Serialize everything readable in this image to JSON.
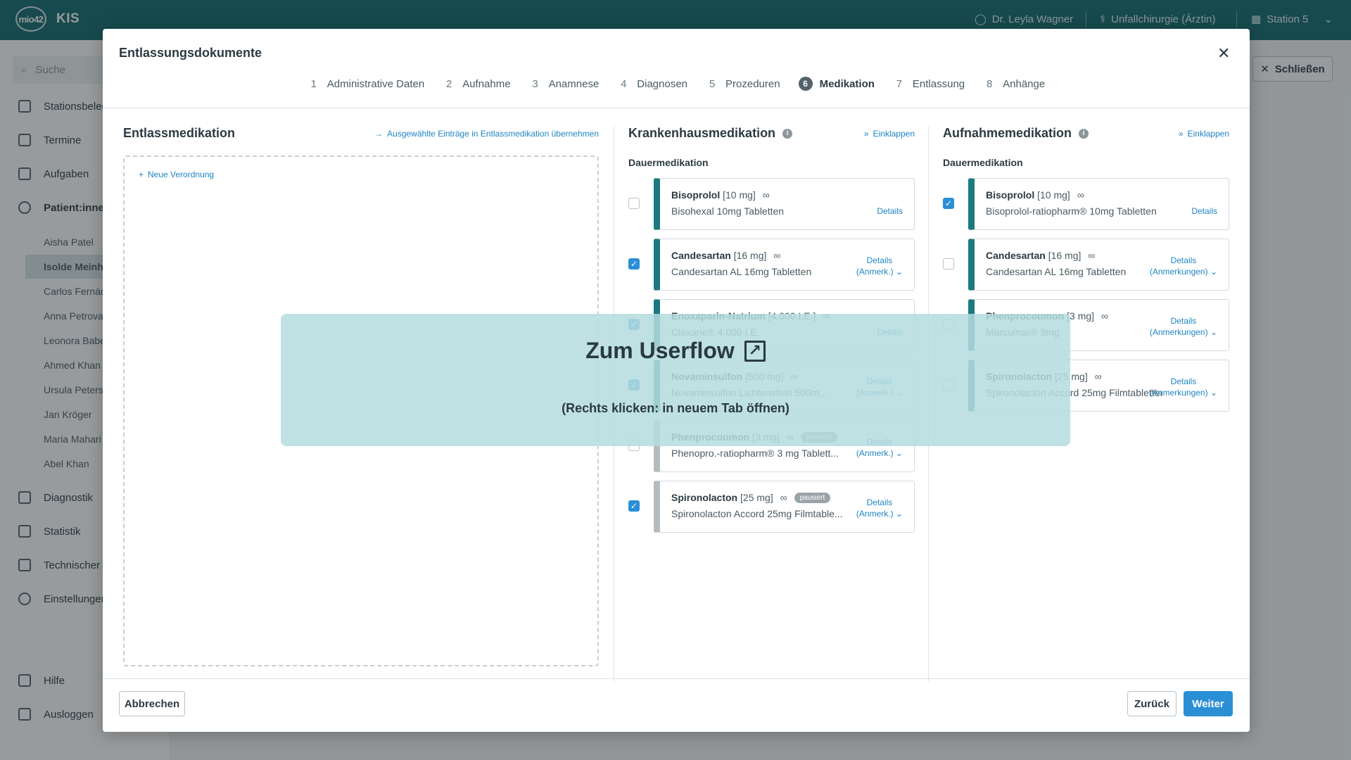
{
  "topbar": {
    "logo": "mio42",
    "app": "KIS",
    "user": "Dr. Leyla Wagner",
    "role": "Unfallchirurgie (Ärztin)",
    "station": "Station 5"
  },
  "sidebar": {
    "search_placeholder": "Suche",
    "items": [
      "Stationsbelegung",
      "Termine",
      "Aufgaben",
      "Patient:innen",
      "Diagnostik",
      "Statistik",
      "Technischer Dienst",
      "Einstellungen"
    ],
    "patients": [
      "Aisha Patel",
      "Isolde Meinhardt",
      "Carlos Fernández",
      "Anna Petrova",
      "Leonora Babeș",
      "Ahmed Khan",
      "Ursula Peters",
      "Jan Kröger",
      "Maria Mahari",
      "Abel Khan"
    ],
    "help": "Hilfe",
    "logout": "Ausloggen"
  },
  "background": {
    "close_button": "Schließen"
  },
  "modal": {
    "title": "Entlassungsdokumente",
    "steps": [
      {
        "n": "1",
        "label": "Administrative Daten"
      },
      {
        "n": "2",
        "label": "Aufnahme"
      },
      {
        "n": "3",
        "label": "Anamnese"
      },
      {
        "n": "4",
        "label": "Diagnosen"
      },
      {
        "n": "5",
        "label": "Prozeduren"
      },
      {
        "n": "6",
        "label": "Medikation"
      },
      {
        "n": "7",
        "label": "Entlassung"
      },
      {
        "n": "8",
        "label": "Anhänge"
      }
    ],
    "entlass": {
      "title": "Entlassmedikation",
      "action": "Ausgewählte Einträge in Entlassmedikation übernehmen",
      "new": "Neue Verordnung"
    },
    "kh": {
      "title": "Krankenhausmedikation",
      "collapse": "Einklappen",
      "section": "Dauermedikation",
      "cards": [
        {
          "name": "Bisoprolol",
          "dose": "[10 mg]",
          "sub": "Bisohexal 10mg Tabletten",
          "d1": "Details",
          "d2": "",
          "checked": false,
          "grey": false,
          "pill": ""
        },
        {
          "name": "Candesartan",
          "dose": "[16 mg]",
          "sub": "Candesartan AL 16mg Tabletten",
          "d1": "Details",
          "d2": "(Anmerk.)",
          "checked": true,
          "grey": false,
          "pill": ""
        },
        {
          "name": "Enoxaparin-Natrium",
          "dose": "[4.000 I.E.]",
          "sub": "Clexane® 4.000 I.E.",
          "d1": "Details",
          "d2": "",
          "checked": true,
          "grey": false,
          "pill": ""
        },
        {
          "name": "Novaminsulfon",
          "dose": "[500 mg]",
          "sub": "Novaminsulfon Lichtenstein 500m...",
          "d1": "Details",
          "d2": "(Anmerk.)",
          "checked": true,
          "grey": false,
          "pill": ""
        },
        {
          "name": "Phenprocoumon",
          "dose": "[3 mg]",
          "sub": "Phenopro.-ratiopharm® 3 mg Tablett...",
          "d1": "Details",
          "d2": "(Anmerk.)",
          "checked": false,
          "grey": true,
          "pill": "pausiert"
        },
        {
          "name": "Spironolacton",
          "dose": "[25 mg]",
          "sub": "Spironolacton Accord 25mg Filmtable...",
          "d1": "Details",
          "d2": "(Anmerk.)",
          "checked": true,
          "grey": true,
          "pill": "pausiert"
        }
      ]
    },
    "auf": {
      "title": "Aufnahmemedikation",
      "collapse": "Einklappen",
      "section": "Dauermedikation",
      "cards": [
        {
          "name": "Bisoprolol",
          "dose": "[10 mg]",
          "sub": "Bisoprolol-ratiopharm® 10mg Tabletten",
          "d1": "Details",
          "d2": "",
          "checked": true
        },
        {
          "name": "Candesartan",
          "dose": "[16 mg]",
          "sub": "Candesartan AL 16mg Tabletten",
          "d1": "Details",
          "d2": "(Anmerkungen)",
          "checked": false
        },
        {
          "name": "Phenprocoumon",
          "dose": "[3 mg]",
          "sub": "Marcumar® 3mg",
          "d1": "Details",
          "d2": "(Anmerkungen)",
          "checked": false
        },
        {
          "name": "Spironolacton",
          "dose": "[25 mg]",
          "sub": "Spironolacton Accord 25mg Filmtabletten",
          "d1": "Details",
          "d2": "(Anmerkungen)",
          "checked": false
        }
      ]
    },
    "footer": {
      "cancel": "Abbrechen",
      "back": "Zurück",
      "next": "Weiter"
    }
  },
  "userflow": {
    "title": "Zum Userflow",
    "hint": "(Rechts klicken: in neuem Tab öffnen)"
  }
}
